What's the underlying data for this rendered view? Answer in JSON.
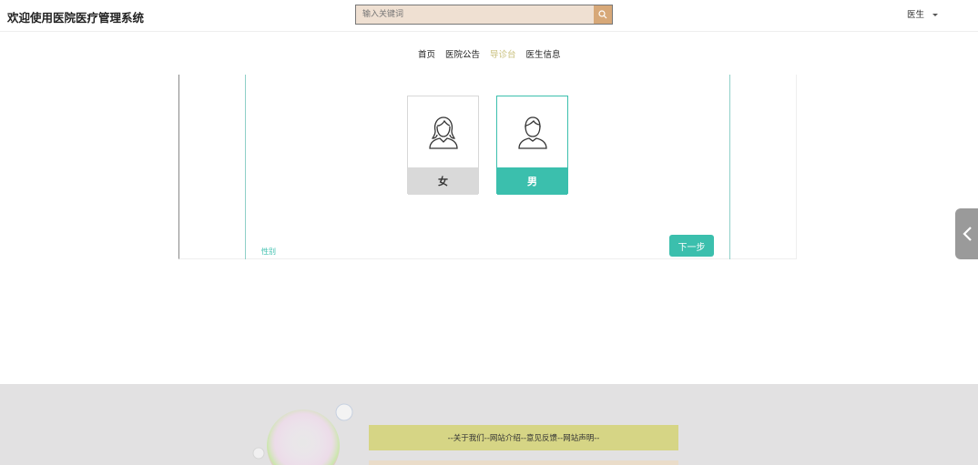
{
  "header": {
    "site_title": "欢迎使用医院医疗管理系统",
    "search_placeholder": "输入关键词",
    "user_menu_label": "医生"
  },
  "nav": {
    "items": [
      {
        "label": "首页",
        "active": false
      },
      {
        "label": "医院公告",
        "active": false
      },
      {
        "label": "导诊台",
        "active": true
      },
      {
        "label": "医生信息",
        "active": false
      }
    ]
  },
  "wizard": {
    "options": [
      {
        "label": "女",
        "icon": "female-avatar-icon",
        "selected": false
      },
      {
        "label": "男",
        "icon": "male-avatar-icon",
        "selected": true
      }
    ],
    "step_label": "性别",
    "next_button": "下一步"
  },
  "footer": {
    "links_text": "--关于我们--网站介绍--意见反馈--网站声明--"
  },
  "colors": {
    "accent": "#3bbfad",
    "nav_active": "#c9c07d",
    "search_bg": "#efe0d2",
    "search_button": "#d7a878",
    "footer_bg": "#e2e1e2",
    "footer_links_bg": "#d6d585"
  }
}
